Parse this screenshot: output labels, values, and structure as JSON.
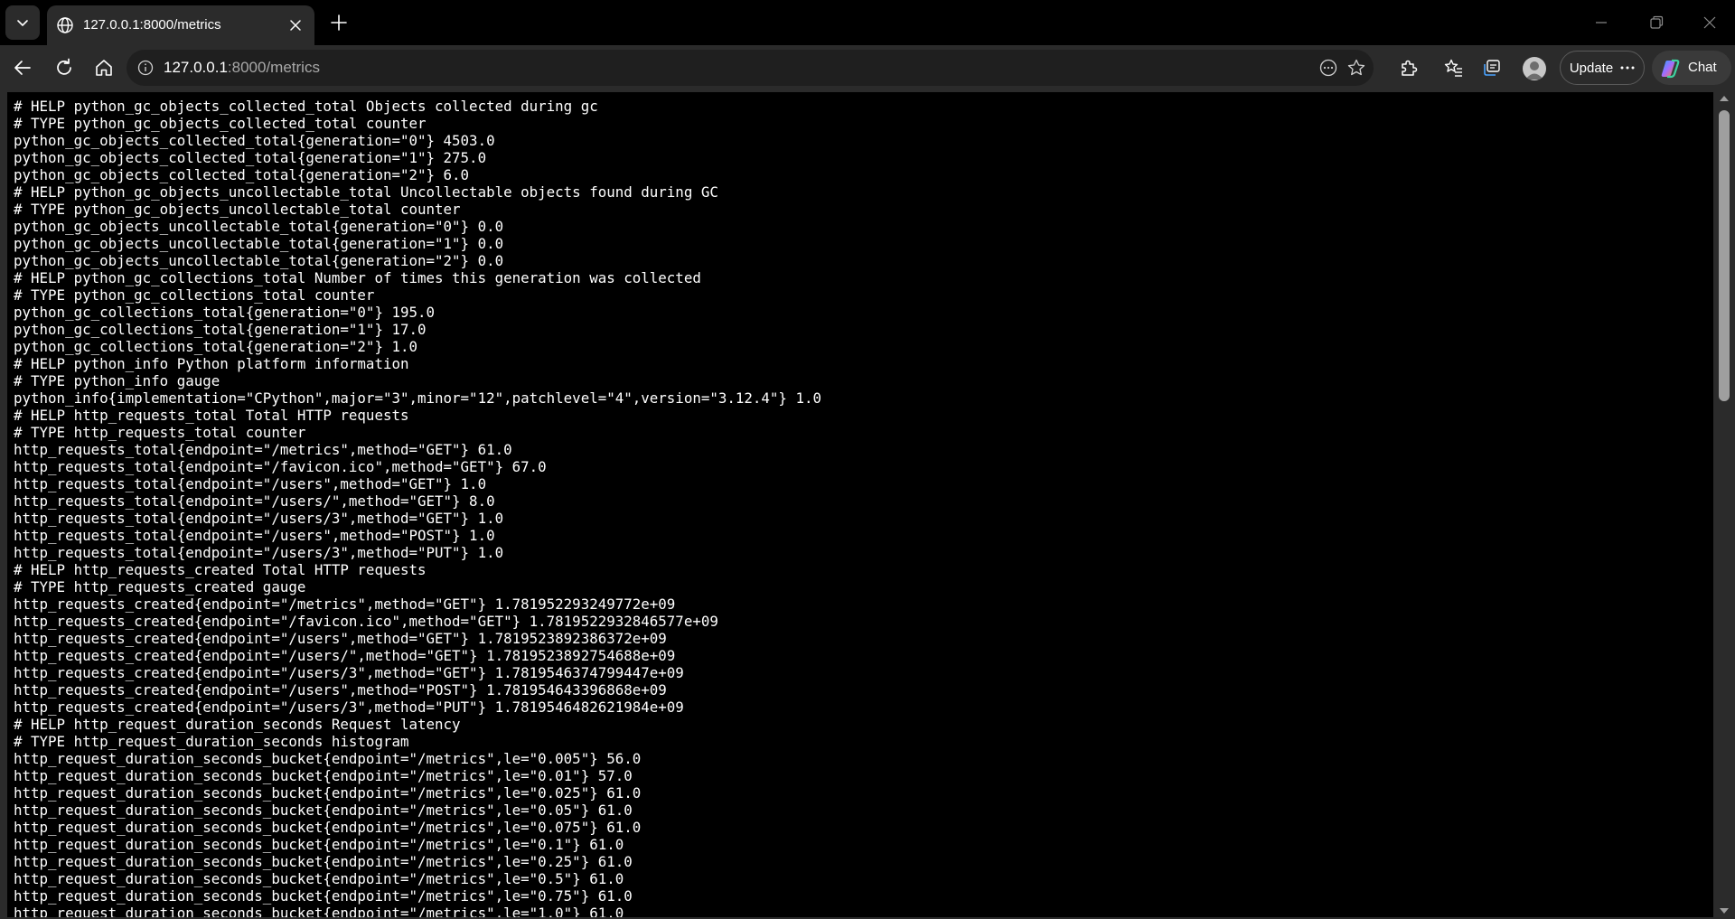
{
  "browser": {
    "tab": {
      "title": "127.0.0.1:8000/metrics",
      "favicon": "globe-icon"
    },
    "address": {
      "host": "127.0.0.1",
      "path": ":8000/metrics"
    },
    "buttons": {
      "update_label": "Update",
      "chat_label": "Chat"
    }
  },
  "metrics_lines": [
    "# HELP python_gc_objects_collected_total Objects collected during gc",
    "# TYPE python_gc_objects_collected_total counter",
    "python_gc_objects_collected_total{generation=\"0\"} 4503.0",
    "python_gc_objects_collected_total{generation=\"1\"} 275.0",
    "python_gc_objects_collected_total{generation=\"2\"} 6.0",
    "# HELP python_gc_objects_uncollectable_total Uncollectable objects found during GC",
    "# TYPE python_gc_objects_uncollectable_total counter",
    "python_gc_objects_uncollectable_total{generation=\"0\"} 0.0",
    "python_gc_objects_uncollectable_total{generation=\"1\"} 0.0",
    "python_gc_objects_uncollectable_total{generation=\"2\"} 0.0",
    "# HELP python_gc_collections_total Number of times this generation was collected",
    "# TYPE python_gc_collections_total counter",
    "python_gc_collections_total{generation=\"0\"} 195.0",
    "python_gc_collections_total{generation=\"1\"} 17.0",
    "python_gc_collections_total{generation=\"2\"} 1.0",
    "# HELP python_info Python platform information",
    "# TYPE python_info gauge",
    "python_info{implementation=\"CPython\",major=\"3\",minor=\"12\",patchlevel=\"4\",version=\"3.12.4\"} 1.0",
    "# HELP http_requests_total Total HTTP requests",
    "# TYPE http_requests_total counter",
    "http_requests_total{endpoint=\"/metrics\",method=\"GET\"} 61.0",
    "http_requests_total{endpoint=\"/favicon.ico\",method=\"GET\"} 67.0",
    "http_requests_total{endpoint=\"/users\",method=\"GET\"} 1.0",
    "http_requests_total{endpoint=\"/users/\",method=\"GET\"} 8.0",
    "http_requests_total{endpoint=\"/users/3\",method=\"GET\"} 1.0",
    "http_requests_total{endpoint=\"/users\",method=\"POST\"} 1.0",
    "http_requests_total{endpoint=\"/users/3\",method=\"PUT\"} 1.0",
    "# HELP http_requests_created Total HTTP requests",
    "# TYPE http_requests_created gauge",
    "http_requests_created{endpoint=\"/metrics\",method=\"GET\"} 1.781952293249772e+09",
    "http_requests_created{endpoint=\"/favicon.ico\",method=\"GET\"} 1.7819522932846577e+09",
    "http_requests_created{endpoint=\"/users\",method=\"GET\"} 1.7819523892386372e+09",
    "http_requests_created{endpoint=\"/users/\",method=\"GET\"} 1.7819523892754688e+09",
    "http_requests_created{endpoint=\"/users/3\",method=\"GET\"} 1.7819546374799447e+09",
    "http_requests_created{endpoint=\"/users\",method=\"POST\"} 1.781954643396868e+09",
    "http_requests_created{endpoint=\"/users/3\",method=\"PUT\"} 1.7819546482621984e+09",
    "# HELP http_request_duration_seconds Request latency",
    "# TYPE http_request_duration_seconds histogram",
    "http_request_duration_seconds_bucket{endpoint=\"/metrics\",le=\"0.005\"} 56.0",
    "http_request_duration_seconds_bucket{endpoint=\"/metrics\",le=\"0.01\"} 57.0",
    "http_request_duration_seconds_bucket{endpoint=\"/metrics\",le=\"0.025\"} 61.0",
    "http_request_duration_seconds_bucket{endpoint=\"/metrics\",le=\"0.05\"} 61.0",
    "http_request_duration_seconds_bucket{endpoint=\"/metrics\",le=\"0.075\"} 61.0",
    "http_request_duration_seconds_bucket{endpoint=\"/metrics\",le=\"0.1\"} 61.0",
    "http_request_duration_seconds_bucket{endpoint=\"/metrics\",le=\"0.25\"} 61.0",
    "http_request_duration_seconds_bucket{endpoint=\"/metrics\",le=\"0.5\"} 61.0",
    "http_request_duration_seconds_bucket{endpoint=\"/metrics\",le=\"0.75\"} 61.0",
    "http_request_duration_seconds_bucket{endpoint=\"/metrics\",le=\"1.0\"} 61.0"
  ],
  "icons": {
    "tab_menu": "chevron-down-icon",
    "tab_close": "close-icon",
    "new_tab": "plus-icon",
    "back": "back-arrow-icon",
    "reload": "reload-icon",
    "home": "home-icon",
    "site_info": "info-icon",
    "read_aloud": "more-icon",
    "favorite": "star-icon",
    "extensions": "puzzle-icon",
    "favorites": "favorites-icon",
    "collections": "collections-icon",
    "profile": "profile-icon",
    "copilot": "copilot-icon"
  },
  "colors": {
    "chrome_bg": "#2b2b2b",
    "page_bg": "#000000",
    "text": "#ffffff",
    "url_path": "#a8a8a8"
  }
}
